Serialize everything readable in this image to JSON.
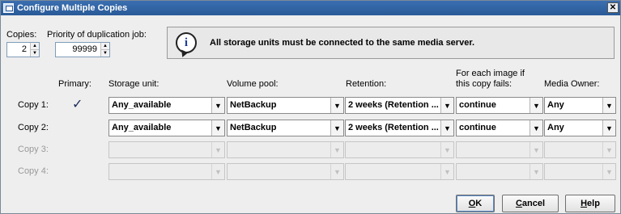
{
  "window": {
    "title": "Configure Multiple Copies",
    "close_glyph": "✕"
  },
  "copies": {
    "label": "Copies:",
    "value": "2"
  },
  "priority": {
    "label": "Priority of duplication job:",
    "value": "99999"
  },
  "info": {
    "icon": "info-icon",
    "message": "All storage units must be connected to the same media server."
  },
  "headers": {
    "primary": "Primary:",
    "storage_unit": "Storage unit:",
    "volume_pool": "Volume pool:",
    "retention": "Retention:",
    "fail_action_line1": "For each image if",
    "fail_action_line2": "this copy fails:",
    "media_owner": "Media Owner:"
  },
  "rows": [
    {
      "label": "Copy 1:",
      "primary": "✓",
      "storage_unit": "Any_available",
      "volume_pool": "NetBackup",
      "retention": "2 weeks (Retention ...",
      "on_fail": "continue",
      "media_owner": "Any",
      "enabled": true
    },
    {
      "label": "Copy 2:",
      "primary": "",
      "storage_unit": "Any_available",
      "volume_pool": "NetBackup",
      "retention": "2 weeks (Retention ...",
      "on_fail": "continue",
      "media_owner": "Any",
      "enabled": true
    },
    {
      "label": "Copy 3:",
      "primary": "",
      "storage_unit": "",
      "volume_pool": "",
      "retention": "",
      "on_fail": "",
      "media_owner": "",
      "enabled": false
    },
    {
      "label": "Copy 4:",
      "primary": "",
      "storage_unit": "",
      "volume_pool": "",
      "retention": "",
      "on_fail": "",
      "media_owner": "",
      "enabled": false
    }
  ],
  "buttons": {
    "ok_mnemonic": "O",
    "ok_rest": "K",
    "cancel_mnemonic": "C",
    "cancel_rest": "ancel",
    "help_mnemonic": "H",
    "help_rest": "elp"
  },
  "colors": {
    "titlebar": "#2a5a98",
    "background": "#eeeeee",
    "disabled_text": "#9a9a9a"
  }
}
